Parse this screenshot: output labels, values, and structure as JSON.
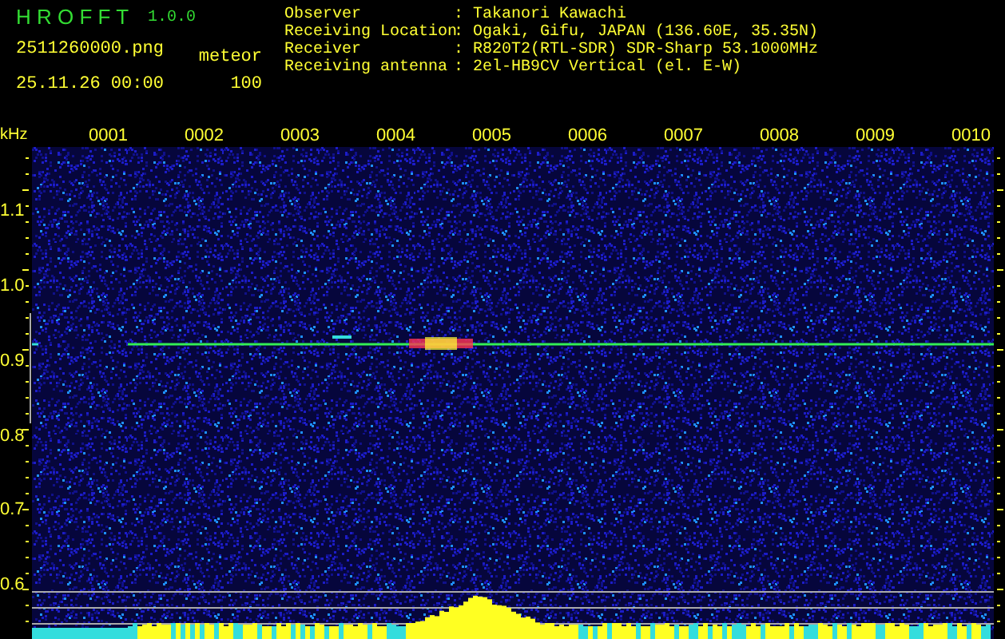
{
  "header": {
    "title": "H R O F F T",
    "version": "1.0.0",
    "file_name": "2511260000.png",
    "date_time": "25.11.26 00:00",
    "mode": "meteor",
    "count": "100"
  },
  "station_info": [
    {
      "label": "Observer",
      "separator": ":",
      "value": "Takanori Kawachi"
    },
    {
      "label": "Receiving Location",
      "separator": ":",
      "value": "Ogaki, Gifu, JAPAN (136.60E, 35.35N)"
    },
    {
      "label": "Receiver",
      "separator": ":",
      "value": "R820T2(RTL-SDR) SDR-Sharp 53.1000MHz"
    },
    {
      "label": "Receiving antenna",
      "separator": ":",
      "value": "2el-HB9CV Vertical (el. E-W)"
    }
  ],
  "spectrogram": {
    "y_unit": "kHz",
    "x_labels": [
      "0001",
      "0002",
      "0003",
      "0004",
      "0005",
      "0006",
      "0007",
      "0008",
      "0009",
      "0010"
    ],
    "y_labels": [
      "1.1",
      "1.0",
      "0.9",
      "0.8",
      "0.7",
      "0.6"
    ]
  }
}
